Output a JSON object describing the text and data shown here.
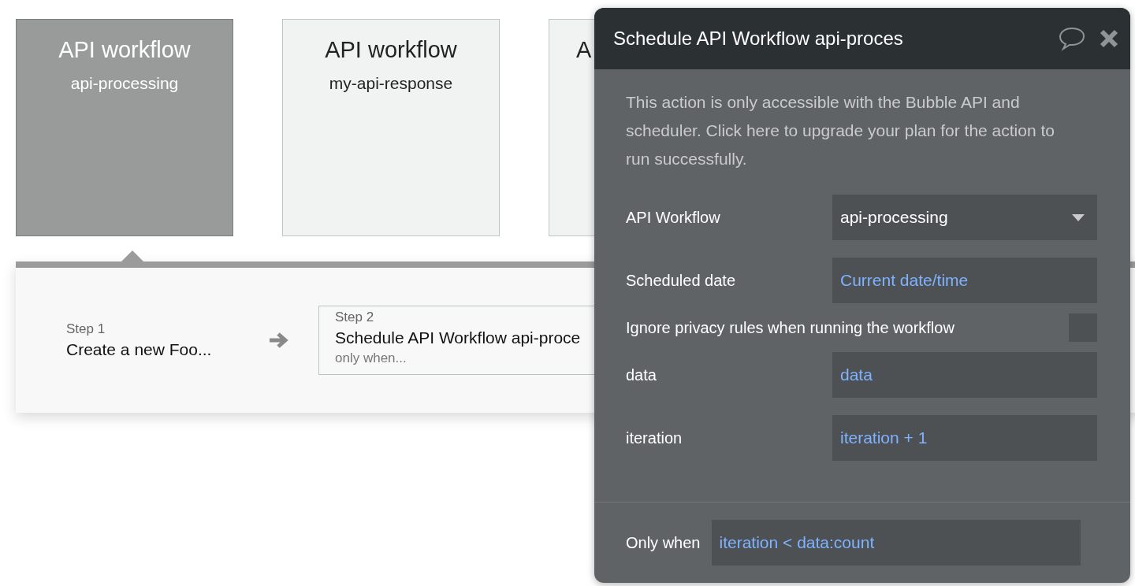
{
  "cards": [
    {
      "title": "API workflow",
      "subtitle": "api-processing",
      "selected": true
    },
    {
      "title": "API workflow",
      "subtitle": "my-api-response",
      "selected": false
    },
    {
      "title": "A",
      "selected": false
    }
  ],
  "steps": [
    {
      "label": "Step 1",
      "title": "Create a new Foo...",
      "selected": false
    },
    {
      "label": "Step 2",
      "title": "Schedule API Workflow api-proce",
      "condition": "only when...",
      "selected": true
    }
  ],
  "panel": {
    "title": "Schedule API Workflow api-proces",
    "notice": "This action is only accessible with the Bubble API and scheduler. Click here to upgrade your plan for the action to run successfully.",
    "fields": [
      {
        "kind": "dropdown",
        "label": "API Workflow",
        "value": "api-processing"
      },
      {
        "kind": "expression",
        "label": "Scheduled date",
        "value": "Current date/time"
      },
      {
        "kind": "checkbox",
        "label": "Ignore privacy rules when running the workflow",
        "checked": false
      },
      {
        "kind": "expression",
        "label": "data",
        "value": "data"
      },
      {
        "kind": "expression",
        "label": "iteration",
        "value": "iteration + 1"
      }
    ],
    "only_when": {
      "label": "Only when",
      "value": "iteration < data:count"
    }
  }
}
